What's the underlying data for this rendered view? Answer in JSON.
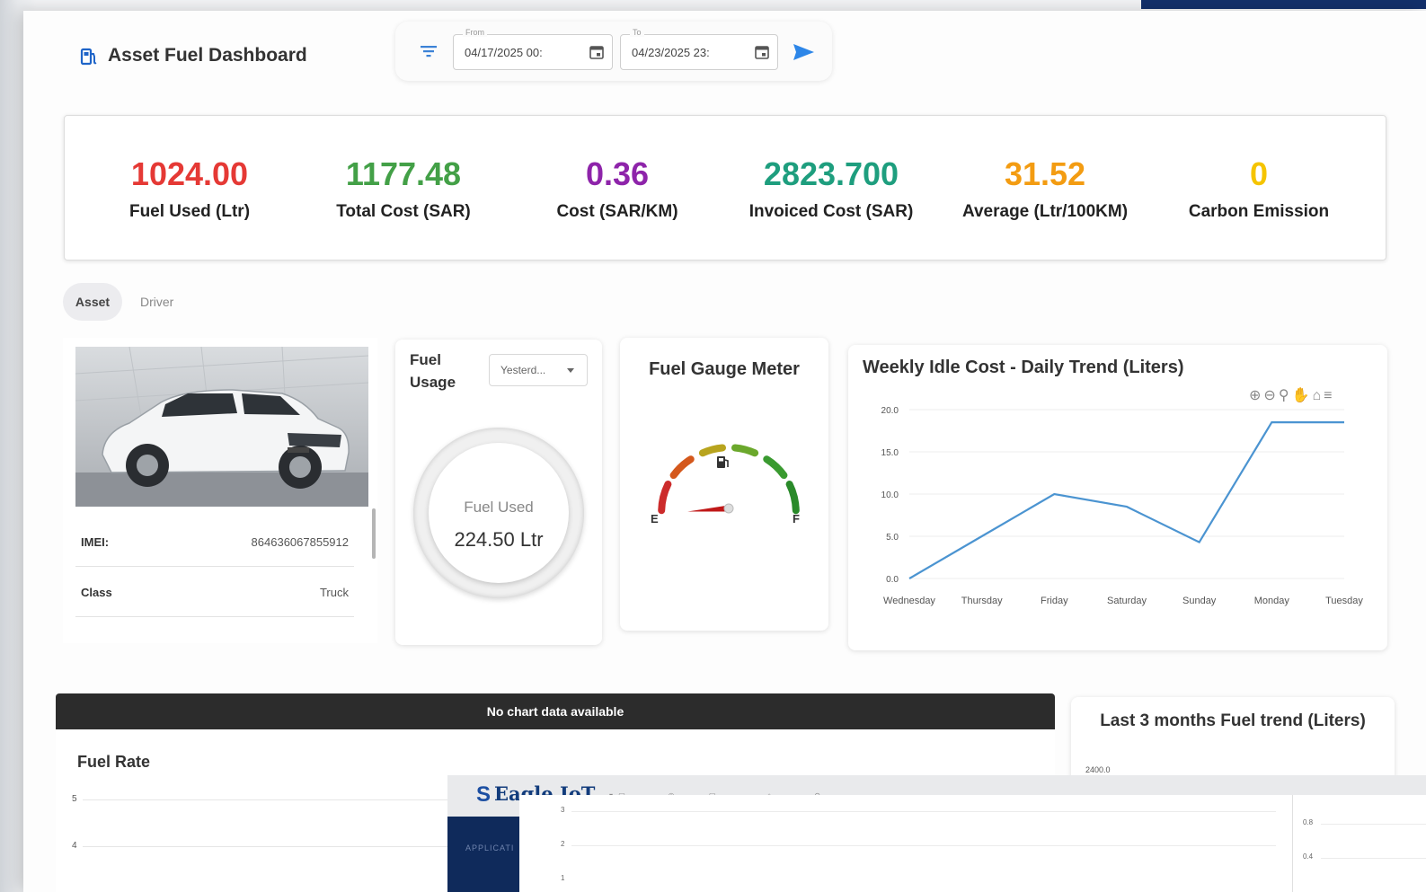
{
  "header": {
    "title": "Asset Fuel Dashboard"
  },
  "filters": {
    "from_label": "From",
    "from_value": "04/17/2025 00:",
    "to_label": "To",
    "to_value": "04/23/2025 23:"
  },
  "kpis": [
    {
      "value": "1024.00",
      "label": "Fuel Used (Ltr)",
      "color": "#e53935"
    },
    {
      "value": "1177.48",
      "label": "Total Cost (SAR)",
      "color": "#43a047"
    },
    {
      "value": "0.36",
      "label": "Cost (SAR/KM)",
      "color": "#8e24aa"
    },
    {
      "value": "2823.700",
      "label": "Invoiced Cost (SAR)",
      "color": "#1e9e7e"
    },
    {
      "value": "31.52",
      "label": "Average (Ltr/100KM)",
      "color": "#f39c12"
    },
    {
      "value": "0",
      "label": "Carbon Emission",
      "color": "#f5c400"
    }
  ],
  "tabs": {
    "asset": "Asset",
    "driver": "Driver"
  },
  "asset_info": {
    "imei_label": "IMEI:",
    "imei_value": "864636067855912",
    "class_label": "Class",
    "class_value": "Truck"
  },
  "fuel_usage": {
    "title_line1": "Fuel",
    "title_line2": "Usage",
    "period": "Yesterd...",
    "ring_label": "Fuel Used",
    "ring_value": "224.50 Ltr"
  },
  "gauge": {
    "title": "Fuel Gauge Meter",
    "empty_label": "E",
    "full_label": "F",
    "level": 0.02
  },
  "weekly": {
    "title": "Weekly Idle Cost - Daily Trend (Liters)",
    "toolbar_icons": [
      "zoom-in-icon",
      "zoom-out-icon",
      "magnify-icon",
      "pan-icon",
      "home-icon",
      "menu-icon"
    ]
  },
  "chart_data": {
    "type": "line",
    "title": "Weekly Idle Cost - Daily Trend (Liters)",
    "categories": [
      "Wednesday",
      "Thursday",
      "Friday",
      "Saturday",
      "Sunday",
      "Monday",
      "Tuesday"
    ],
    "series": [
      {
        "values": [
          0.0,
          5.0,
          10.0,
          8.5,
          4.3,
          18.5,
          18.5
        ],
        "color": "#4b94d1"
      }
    ],
    "yticks": [
      "0.0",
      "5.0",
      "10.0",
      "15.0",
      "20.0"
    ],
    "ylim": [
      0,
      20
    ],
    "grid": true
  },
  "no_data": "No chart data available",
  "fuel_rate": {
    "title": "Fuel Rate",
    "ticks": [
      "5",
      "4"
    ]
  },
  "last3": {
    "title": "Last 3 months Fuel trend (Liters)",
    "tick": "2400.0"
  },
  "overlay": {
    "brand": "Eagle IoT",
    "panel_ticks_left": [
      "3",
      "2",
      "1"
    ],
    "panel_ticks_right": [
      "0.8",
      "0.4"
    ]
  }
}
